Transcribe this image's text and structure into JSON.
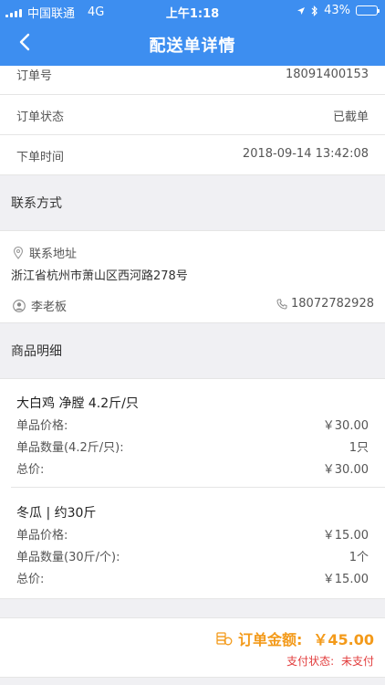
{
  "status_bar": {
    "carrier": "中国联通",
    "network": "4G",
    "time": "上午1:18",
    "battery": "43%",
    "battery_level": 0.43
  },
  "header": {
    "title": "配送单详情"
  },
  "order": {
    "rows": [
      {
        "label": "订单号",
        "value": "18091400153"
      },
      {
        "label": "订单状态",
        "value": "已截单"
      },
      {
        "label": "下单时间",
        "value": "2018-09-14 13:42:08"
      }
    ]
  },
  "contact": {
    "section_title": "联系方式",
    "address_label": "联系地址",
    "address": "浙江省杭州市萧山区西河路278号",
    "person": "李老板",
    "phone": "18072782928"
  },
  "products": {
    "section_title": "商品明细",
    "items": [
      {
        "name": "大白鸡 净膛 4.2斤/只",
        "unit_price_label": "单品价格:",
        "unit_price": "￥30.00",
        "qty_label": "单品数量(4.2斤/只):",
        "qty": "1只",
        "total_label": "总价:",
        "total": "￥30.00"
      },
      {
        "name": "冬瓜 | 约30斤",
        "unit_price_label": "单品价格:",
        "unit_price": "￥15.00",
        "qty_label": "单品数量(30斤/个):",
        "qty": "1个",
        "total_label": "总价:",
        "total": "￥15.00"
      }
    ]
  },
  "summary": {
    "amount_label": "订单金额:",
    "amount": "￥45.00",
    "pay_status_label": "支付状态:",
    "pay_status": "未支付"
  },
  "colors": {
    "header": "#3d8ef0",
    "amount": "#f39a1a",
    "pay_status": "#e23c3c"
  }
}
